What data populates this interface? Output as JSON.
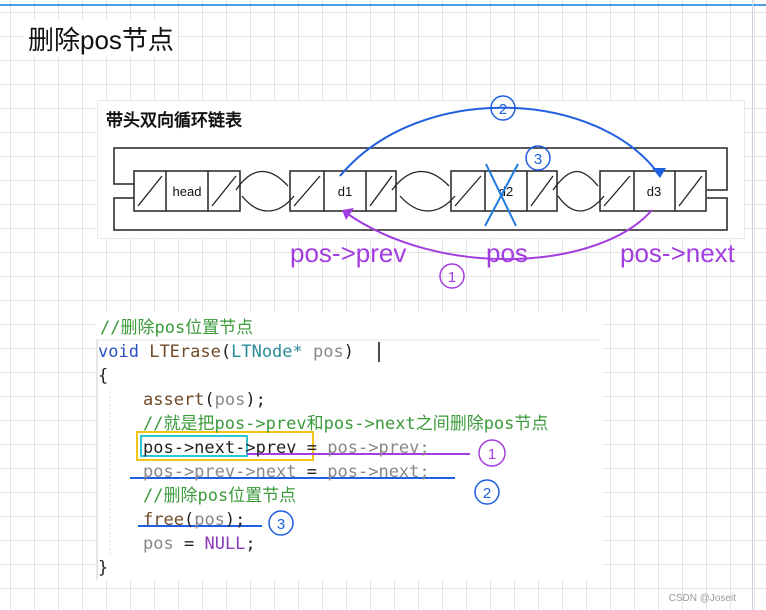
{
  "page_title": "删除pos节点",
  "diagram": {
    "title": "带头双向循环链表",
    "nodes": [
      "head",
      "d1",
      "d2",
      "d3"
    ],
    "labels": {
      "prev": "pos->prev",
      "pos": "pos",
      "next": "pos->next"
    },
    "step_marks": [
      "①",
      "②",
      "③"
    ]
  },
  "code": {
    "comment_header": "//删除pos位置节点",
    "signature_kw": "void",
    "signature_fn": "LTErase",
    "signature_type": "LTNode*",
    "signature_param": "pos",
    "open_brace": "{",
    "line_assert_fn": "assert",
    "line_assert_arg": "pos",
    "comment_between": "//就是把pos->prev和pos->next之间删除pos节点",
    "line1_lhs": "pos->next->prev",
    "line1_rhs": "pos->prev;",
    "line2_lhs": "pos->prev->next",
    "line2_rhs": "pos->next;",
    "comment_delete": "//删除pos位置节点",
    "line_free_fn": "free",
    "line_free_arg": "pos",
    "line_null_var": "pos",
    "line_null_val": "NULL",
    "close_brace": "}"
  },
  "colors": {
    "purple": "#a23de0",
    "blue": "#1f5fe0",
    "yellow": "#f2c418",
    "cyan": "#2ec7d0",
    "comment": "#3a9a3a"
  },
  "watermark": "CSDN @Joseit"
}
